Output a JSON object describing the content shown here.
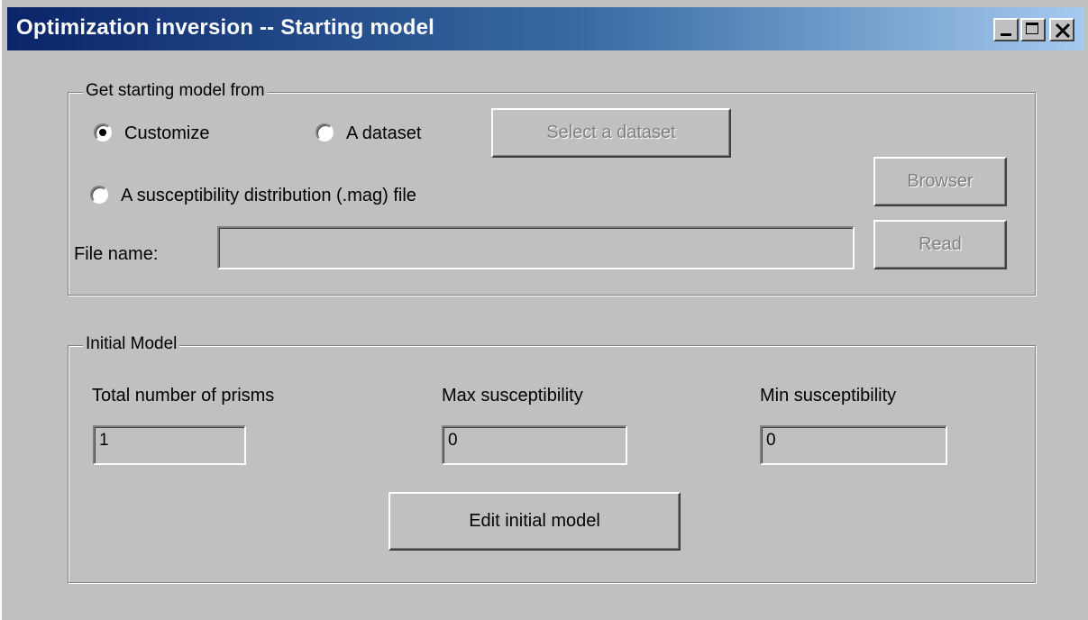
{
  "window": {
    "title": "Optimization inversion -- Starting model",
    "controls": [
      "minimize-icon",
      "maximize-icon",
      "close-icon"
    ]
  },
  "source_group": {
    "legend": "Get starting model  from",
    "radio_customize": "Customize",
    "radio_dataset": "A dataset",
    "radio_mag_file": "A susceptibility distribution (.mag) file",
    "selected": "Customize",
    "select_dataset_button": "Select a dataset",
    "browser_button": "Browser",
    "read_button": "Read",
    "file_name_label": "File name:",
    "file_name_value": ""
  },
  "initial_model": {
    "legend": "Initial Model",
    "total_prisms_label": "Total number of prisms",
    "total_prisms_value": "1",
    "max_susc_label": "Max susceptibility",
    "max_susc_value": "0",
    "min_susc_label": "Min susceptibility",
    "min_susc_value": "0",
    "edit_button": "Edit initial model"
  },
  "colors": {
    "face": "#c0c0c0",
    "title_start": "#0a246a",
    "title_end": "#a6caf0",
    "disabled_text": "#808080"
  }
}
